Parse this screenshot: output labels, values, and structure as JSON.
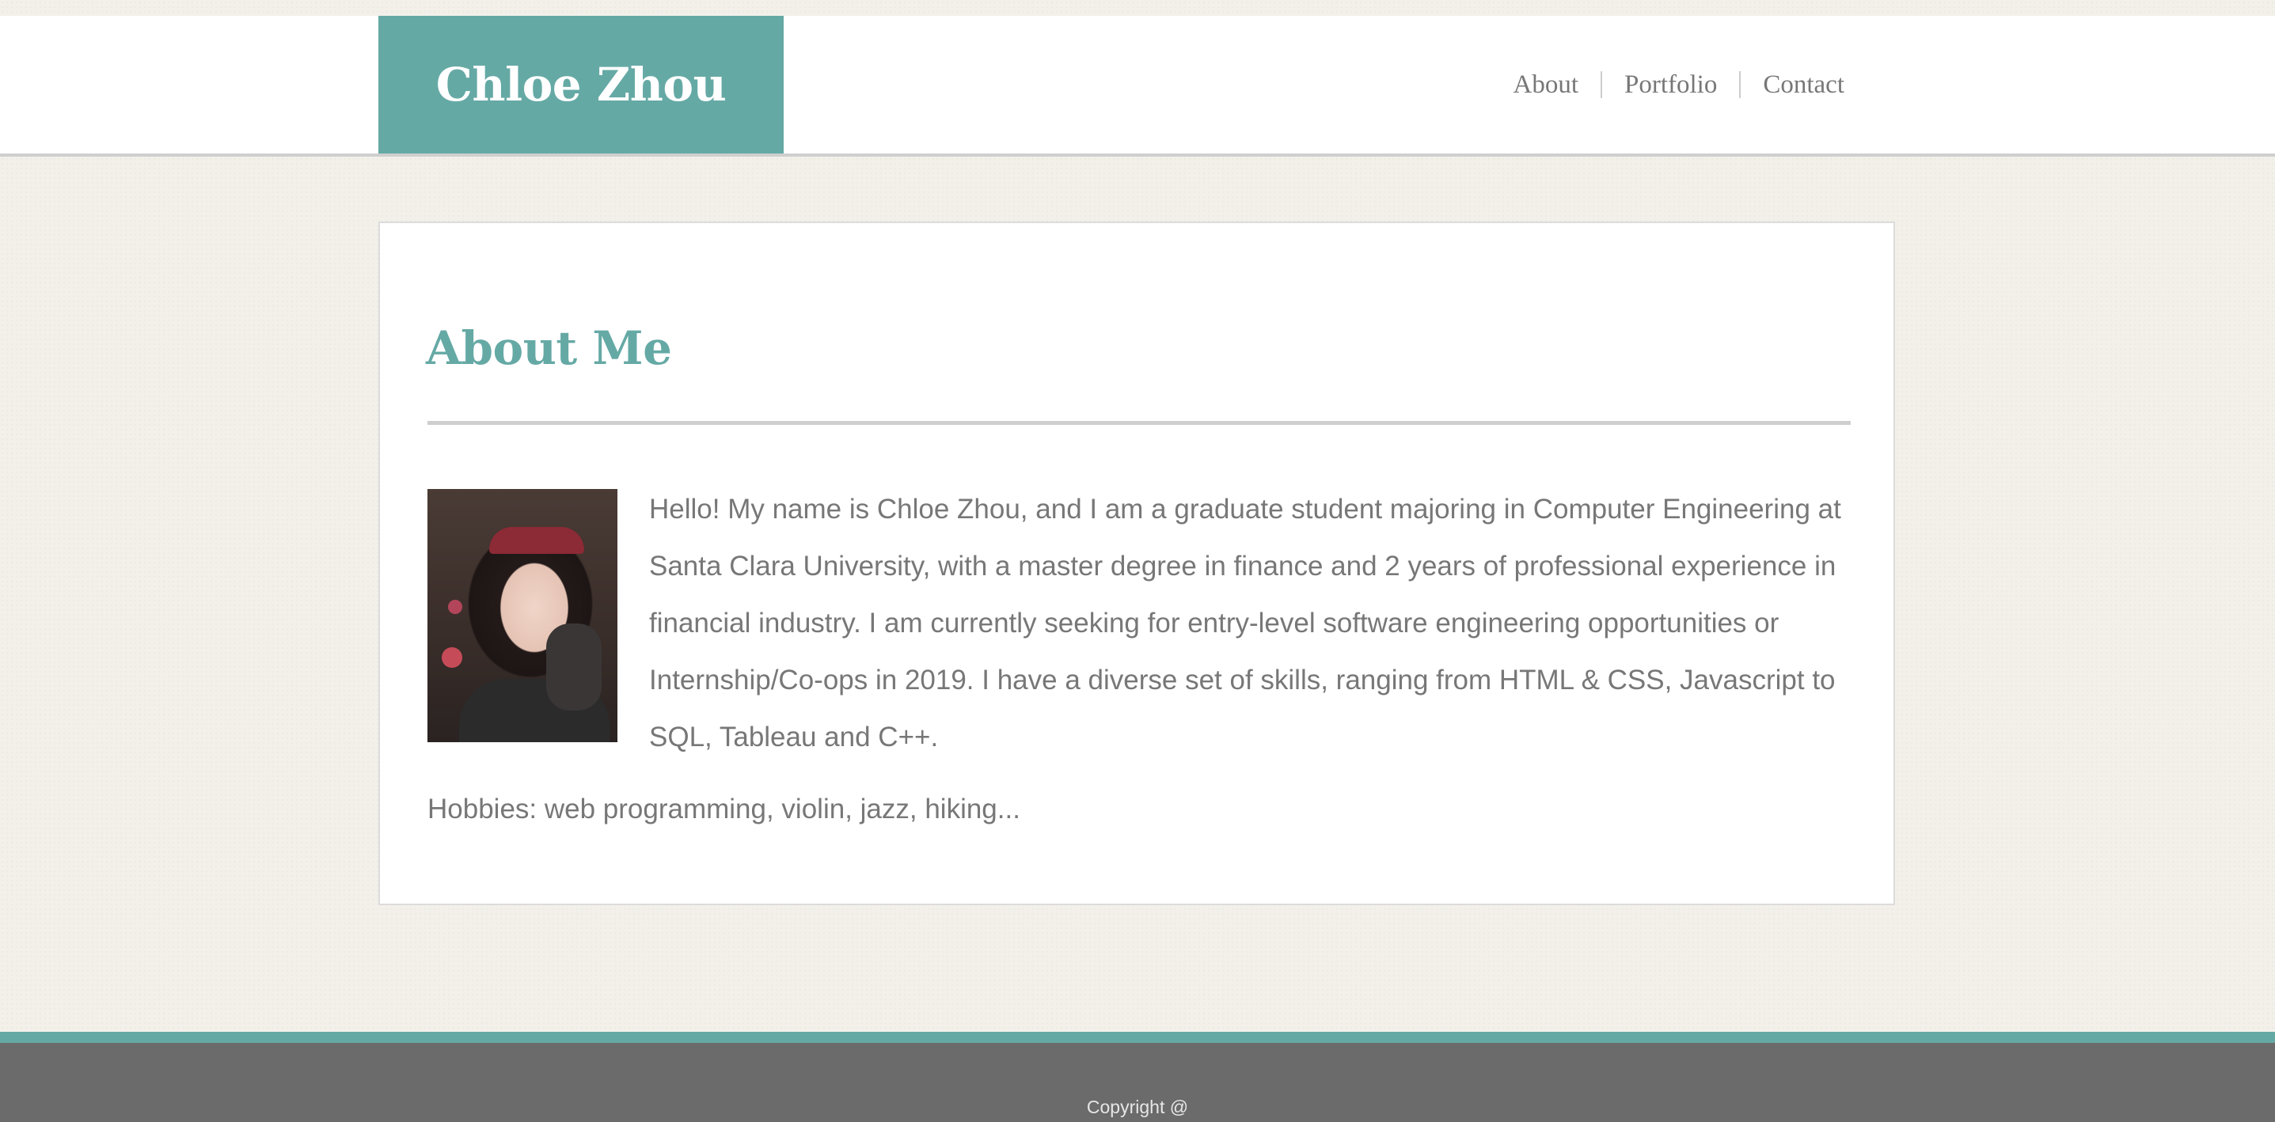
{
  "header": {
    "brand": "Chloe Zhou",
    "nav": [
      {
        "label": "About"
      },
      {
        "label": "Portfolio"
      },
      {
        "label": "Contact"
      }
    ]
  },
  "main": {
    "title": "About Me",
    "photo_alt": "Photo of Chloe Zhou",
    "bio": "Hello! My name is Chloe Zhou, and I am a graduate student majoring in Computer Engineering at Santa Clara University, with a master degree in finance and 2 years of professional experience in financial industry. I am currently seeking for entry-level software engineering opportunities or Internship/Co-ops in 2019. I have a diverse set of skills, ranging from HTML & CSS, Javascript to SQL, Tableau and C++.",
    "hobbies": "Hobbies: web programming, violin, jazz, hiking..."
  },
  "footer": {
    "copyright": "Copyright @"
  },
  "colors": {
    "accent": "#65a9a5",
    "background": "#f3f0ea",
    "text": "#777777",
    "footer": "#6b6b6b"
  }
}
